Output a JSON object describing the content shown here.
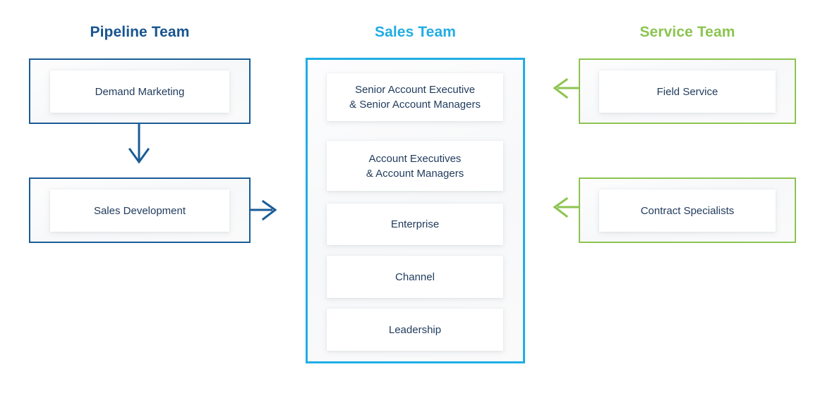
{
  "colors": {
    "pipeline": "#17548F",
    "sales": "#21ADE3",
    "service": "#8CC451",
    "card_text": "#1F3A5C",
    "page_background": "#FFFFFF"
  },
  "columns": {
    "pipeline": {
      "title": "Pipeline Team",
      "groups": [
        {
          "name": "demand-marketing",
          "label": "Demand Marketing"
        },
        {
          "name": "sales-development",
          "label": "Sales Development"
        }
      ]
    },
    "sales": {
      "title": "Sales Team",
      "roles": [
        {
          "name": "senior-account-executive",
          "line1": "Senior Account Executive",
          "line2": "& Senior Account Managers"
        },
        {
          "name": "account-executives",
          "line1": "Account Executives",
          "line2": "& Account Managers"
        },
        {
          "name": "enterprise",
          "line1": "Enterprise",
          "line2": ""
        },
        {
          "name": "channel",
          "line1": "Channel",
          "line2": ""
        },
        {
          "name": "leadership",
          "line1": "Leadership",
          "line2": ""
        }
      ]
    },
    "service": {
      "title": "Service Team",
      "groups": [
        {
          "name": "field-service",
          "label": "Field Service"
        },
        {
          "name": "contract-specialists",
          "label": "Contract Specialists"
        }
      ]
    }
  },
  "connectors": [
    {
      "name": "demand-to-sales-development",
      "icon": "arrow-down-icon",
      "color": "#1A5C96"
    },
    {
      "name": "sales-development-to-sales-team",
      "icon": "arrow-right-icon",
      "color": "#1A5C96"
    },
    {
      "name": "field-service-to-sales-team",
      "icon": "arrow-left-icon",
      "color": "#8CC451"
    },
    {
      "name": "contract-specialists-to-sales-team",
      "icon": "arrow-left-icon",
      "color": "#8CC451"
    }
  ]
}
